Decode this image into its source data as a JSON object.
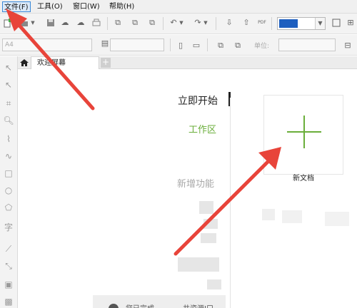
{
  "menubar": {
    "items": [
      {
        "label": "文件(F)",
        "active": true
      },
      {
        "label": "工具(O)"
      },
      {
        "label": "窗口(W)"
      },
      {
        "label": "帮助(H)"
      }
    ]
  },
  "toolbar": {
    "zoom_selected": "",
    "pdf_label": "PDF"
  },
  "property_bar": {
    "page_size": "A4",
    "unit_label": "单位:"
  },
  "tabs": {
    "home_icon": "home-icon",
    "welcome_label": "欢迎屏幕",
    "add_label": "+"
  },
  "welcome": {
    "nav": {
      "start": "立即开始",
      "workspace": "工作区",
      "whats_new": "新增功能"
    },
    "new_document_label": "新文档",
    "recent_strip": {
      "text1": "您已完成",
      "text2": "共资源Ⅰ口"
    }
  },
  "colors": {
    "accent_green": "#6aae3a",
    "arrow_red": "#e8443a",
    "zoom_blue": "#1e5fbf"
  }
}
